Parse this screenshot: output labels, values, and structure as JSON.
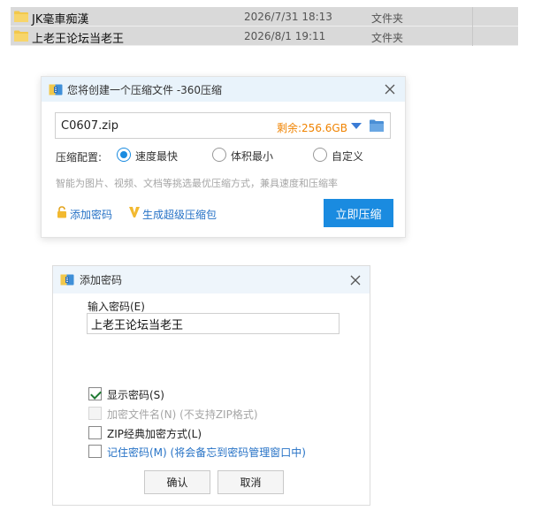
{
  "file_list": {
    "rows": [
      {
        "name": "JK毫車痴漢",
        "date": "2026/7/31 18:13",
        "type": "文件夹"
      },
      {
        "name": "上老王论坛当老王",
        "date": "2026/8/1 19:11",
        "type": "文件夹"
      }
    ]
  },
  "compress_dialog": {
    "title": "您将创建一个压缩文件 -360压缩",
    "filename": "C0607.zip",
    "remaining": "剩余:256.6GB",
    "config_label": "压缩配置:",
    "options": [
      {
        "label": "速度最快",
        "selected": true
      },
      {
        "label": "体积最小",
        "selected": false
      },
      {
        "label": "自定义",
        "selected": false
      }
    ],
    "hint": "智能为图片、视频、文档等挑选最优压缩方式，兼具速度和压缩率",
    "add_password_link": "添加密码",
    "super_package_link": "生成超级压缩包",
    "compress_button": "立即压缩"
  },
  "password_dialog": {
    "title": "添加密码",
    "input_label": "输入密码(E)",
    "input_value": "上老王论坛当老王",
    "checkboxes": [
      {
        "label": "显示密码(S)",
        "checked": true,
        "disabled": false
      },
      {
        "label": "加密文件名(N) (不支持ZIP格式)",
        "checked": false,
        "disabled": true
      },
      {
        "label": "ZIP经典加密方式(L)",
        "checked": false,
        "disabled": false
      },
      {
        "label": "记住密码(M) (将会备忘到密码管理窗口中)",
        "checked": false,
        "disabled": false
      }
    ],
    "ok_button": "确认",
    "cancel_button": "取消"
  },
  "colors": {
    "accent": "#1a8be0",
    "remaining_orange": "#f08300",
    "link_blue": "#2672c6",
    "folder_yellow": "#f2c84b"
  }
}
